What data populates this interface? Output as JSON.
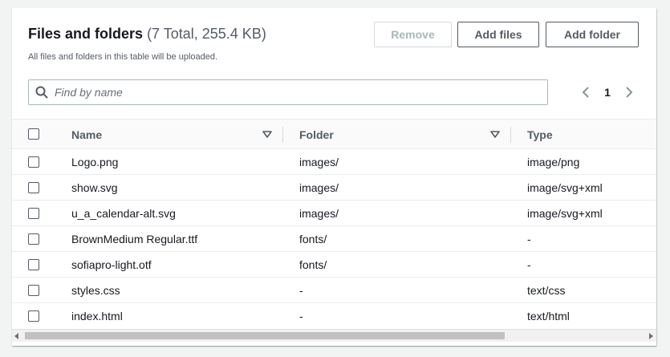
{
  "header": {
    "title": "Files and folders",
    "count": "(7 Total, 255.4 KB)",
    "description": "All files and folders in this table will be uploaded."
  },
  "actions": {
    "remove": "Remove",
    "add_files": "Add files",
    "add_folder": "Add folder"
  },
  "search": {
    "placeholder": "Find by name",
    "value": ""
  },
  "pagination": {
    "current_page": "1"
  },
  "table": {
    "columns": [
      "Name",
      "Folder",
      "Type"
    ],
    "rows": [
      {
        "name": "Logo.png",
        "folder": "images/",
        "type": "image/png"
      },
      {
        "name": "show.svg",
        "folder": "images/",
        "type": "image/svg+xml"
      },
      {
        "name": "u_a_calendar-alt.svg",
        "folder": "images/",
        "type": "image/svg+xml"
      },
      {
        "name": "BrownMedium Regular.ttf",
        "folder": "fonts/",
        "type": "-"
      },
      {
        "name": "sofiapro-light.otf",
        "folder": "fonts/",
        "type": "-"
      },
      {
        "name": "styles.css",
        "folder": "-",
        "type": "text/css"
      },
      {
        "name": "index.html",
        "folder": "-",
        "type": "text/html"
      }
    ]
  },
  "icons": {
    "search": "search-icon",
    "sort": "caret-down-outline-icon",
    "prev": "chevron-left-icon",
    "next": "chevron-right-icon"
  },
  "colors": {
    "background": "#f2f3f3",
    "panel": "#ffffff",
    "text": "#16191f",
    "secondary_text": "#545b64",
    "disabled": "#aab7b8"
  }
}
